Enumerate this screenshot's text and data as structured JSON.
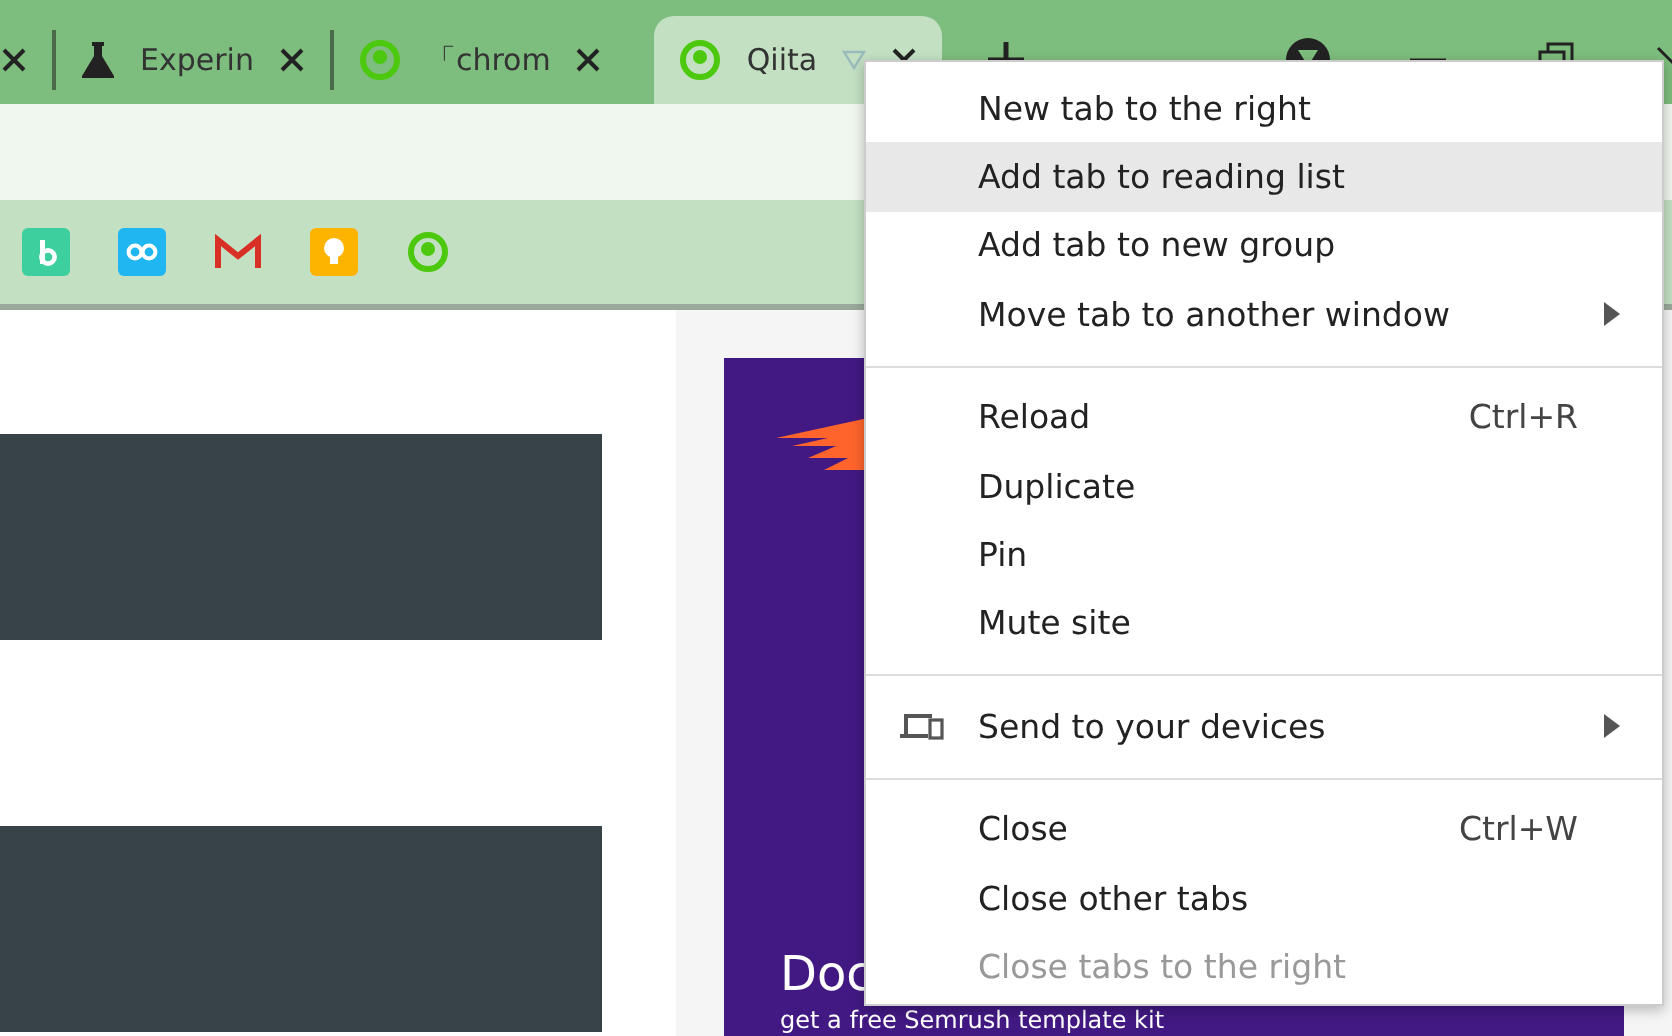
{
  "tabs": [
    {
      "selected": false
    },
    {
      "title": "Experin",
      "selected": false
    },
    {
      "title": "「chrom",
      "selected": false
    },
    {
      "title": "Qiita",
      "selected": true
    }
  ],
  "ad": {
    "lines": [
      "Doc",
      "get a free Semrush template kit"
    ]
  },
  "context_menu": [
    {
      "kind": "item",
      "label": "New tab to the right",
      "selected": false,
      "disabled": false
    },
    {
      "kind": "item",
      "label": "Add tab to reading list",
      "selected": true,
      "disabled": false
    },
    {
      "kind": "item",
      "label": "Add tab to new group",
      "selected": false,
      "disabled": false
    },
    {
      "kind": "item",
      "label": "Move tab to another window",
      "selected": false,
      "disabled": false,
      "submenu": true
    },
    {
      "kind": "separator"
    },
    {
      "kind": "item",
      "label": "Reload",
      "shortcut": "Ctrl+R",
      "selected": false,
      "disabled": false
    },
    {
      "kind": "item",
      "label": "Duplicate",
      "selected": false,
      "disabled": false
    },
    {
      "kind": "item",
      "label": "Pin",
      "selected": false,
      "disabled": false
    },
    {
      "kind": "item",
      "label": "Mute site",
      "selected": false,
      "disabled": false
    },
    {
      "kind": "separator"
    },
    {
      "kind": "item",
      "label": "Send to your devices",
      "selected": false,
      "disabled": false,
      "submenu": true
    },
    {
      "kind": "separator"
    },
    {
      "kind": "item",
      "label": "Close",
      "shortcut": "Ctrl+W",
      "selected": false,
      "disabled": false
    },
    {
      "kind": "item",
      "label": "Close other tabs",
      "selected": false,
      "disabled": false
    },
    {
      "kind": "item",
      "label": "Close tabs to the right",
      "selected": false,
      "disabled": true
    }
  ]
}
